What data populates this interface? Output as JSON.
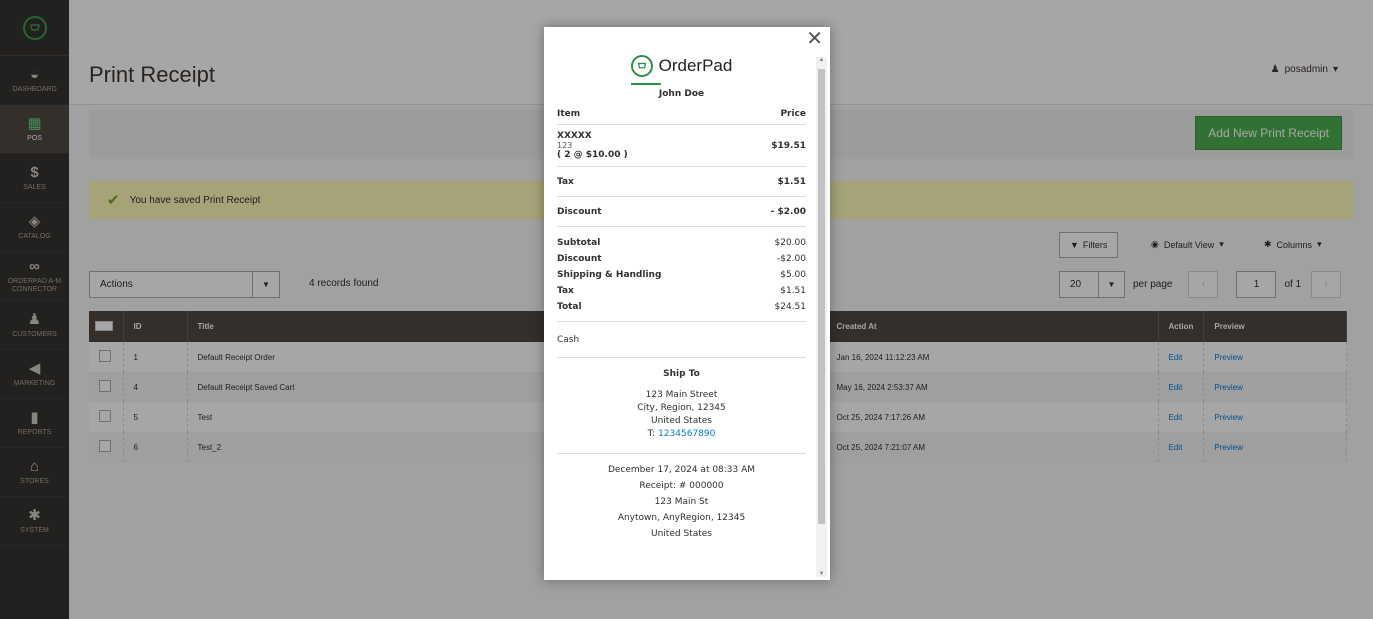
{
  "sidebar": {
    "items": [
      {
        "label": "DASHBOARD",
        "icon": "dashboard-icon",
        "glyph": "◒"
      },
      {
        "label": "POS",
        "icon": "pos-icon",
        "glyph": "▦"
      },
      {
        "label": "SALES",
        "icon": "dollar-icon",
        "glyph": "$"
      },
      {
        "label": "CATALOG",
        "icon": "box-icon",
        "glyph": "◈"
      },
      {
        "label": "ORDERPAD A-M CONNECTOR",
        "icon": "connector-icon",
        "glyph": "∞"
      },
      {
        "label": "CUSTOMERS",
        "icon": "person-icon",
        "glyph": "♟"
      },
      {
        "label": "MARKETING",
        "icon": "megaphone-icon",
        "glyph": "◀"
      },
      {
        "label": "REPORTS",
        "icon": "bar-chart-icon",
        "glyph": "▮"
      },
      {
        "label": "STORES",
        "icon": "store-icon",
        "glyph": "⌂"
      },
      {
        "label": "SYSTEM",
        "icon": "gear-icon",
        "glyph": "✱"
      }
    ]
  },
  "header": {
    "title": "Print Receipt",
    "user": "posadmin",
    "add_button": "Add New Print Receipt"
  },
  "message": "You have saved Print Receipt",
  "toolbar": {
    "filters": "Filters",
    "view": "Default View",
    "columns": "Columns",
    "actions": "Actions",
    "records": "4 records found",
    "per_page_value": "20",
    "per_page_label": "per page",
    "page": "1",
    "of_pages": "of 1"
  },
  "grid": {
    "columns": [
      "ID",
      "Title",
      "Created At",
      "Action",
      "Preview"
    ],
    "rows": [
      {
        "id": "1",
        "title": "Default Receipt Order",
        "created": "Jan 16, 2024 11:12:23 AM",
        "action": "Edit",
        "preview": "Preview"
      },
      {
        "id": "4",
        "title": "Default Receipt Saved Cart",
        "created": "May 16, 2024 2:53:37 AM",
        "action": "Edit",
        "preview": "Preview"
      },
      {
        "id": "5",
        "title": "Test",
        "created": "Oct 25, 2024 7:17:26 AM",
        "action": "Edit",
        "preview": "Preview"
      },
      {
        "id": "6",
        "title": "Test_2",
        "created": "Oct 25, 2024 7:21:07 AM",
        "action": "Edit",
        "preview": "Preview"
      }
    ]
  },
  "receipt": {
    "brand": "OrderPad",
    "customer": "John Doe",
    "item_header": "Item",
    "price_header": "Price",
    "item_name": "XXXXX",
    "item_sku": "123",
    "item_qty": "( 2 @ $10.00 )",
    "item_price": "$19.51",
    "tax_label": "Tax",
    "tax_value": "$1.51",
    "discount_label": "Discount",
    "discount_value": "- $2.00",
    "totals": [
      {
        "label": "Subtotal",
        "value": "$20.00"
      },
      {
        "label": "Discount",
        "value": "-$2.00"
      },
      {
        "label": "Shipping & Handling",
        "value": "$5.00"
      },
      {
        "label": "Tax",
        "value": "$1.51"
      },
      {
        "label": "Total",
        "value": "$24.51"
      }
    ],
    "payment": "Cash",
    "ship_title": "Ship To",
    "ship_street": "123 Main Street",
    "ship_city": "City, Region, 12345",
    "ship_country": "United States",
    "ship_phone_prefix": "T: ",
    "ship_phone": "1234567890",
    "date": "December 17, 2024 at 08:33 AM",
    "receipt_no": "Receipt: # 000000",
    "store_street": "123 Main St",
    "store_city": "Anytown, AnyRegion, 12345",
    "store_country": "United States"
  },
  "colors": {
    "sidebar": "#373330",
    "accent_green": "#4caf50",
    "grid_header": "#514943",
    "link": "#007bdb",
    "message_bg": "#fffbbb"
  }
}
